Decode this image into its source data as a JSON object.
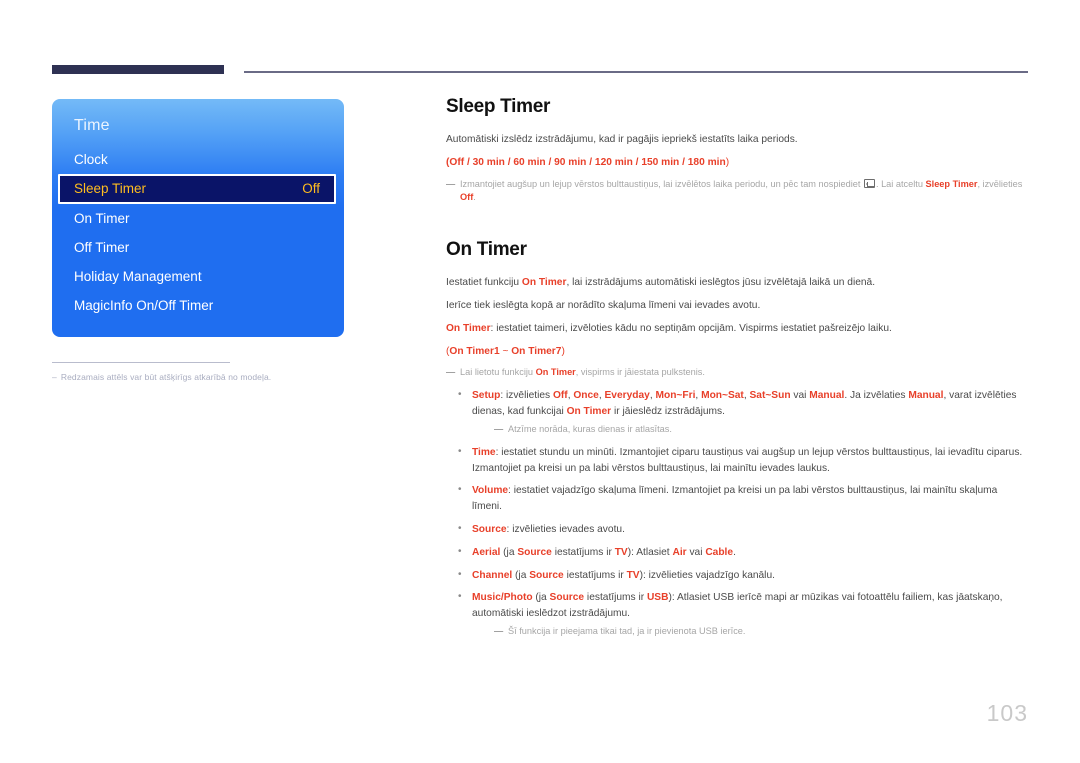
{
  "page": {
    "number": "103"
  },
  "osd": {
    "title": "Time",
    "items": [
      {
        "label": "Clock",
        "value": "",
        "selected": false
      },
      {
        "label": "Sleep Timer",
        "value": "Off",
        "selected": true
      },
      {
        "label": "On Timer",
        "value": "",
        "selected": false
      },
      {
        "label": "Off Timer",
        "value": "",
        "selected": false
      },
      {
        "label": "Holiday Management",
        "value": "",
        "selected": false
      },
      {
        "label": "MagicInfo On/Off Timer",
        "value": "",
        "selected": false
      }
    ],
    "footnote_dash": "–",
    "footnote": "Redzamais attēls var būt atšķirīgs atkarībā no modeļa."
  },
  "sleep_timer": {
    "heading": "Sleep Timer",
    "intro": "Automātiski izslēdz izstrādājumu, kad ir pagājis iepriekš iestatīts laika periods.",
    "options_line": {
      "open": "(",
      "values": "Off / 30 min / 60 min / 90 min / 120 min / 150 min / 180 min",
      "close": ")"
    },
    "note": {
      "dash": "—",
      "part1": "Izmantojiet augšup un lejup vērstos bulttaustiņus, lai izvēlētos laika periodu, un pēc tam nospiediet ",
      "icon": "enter-key-icon",
      "part2": ". Lai atceltu ",
      "accent1": "Sleep Timer",
      "part3": ", izvēlieties ",
      "accent2": "Off",
      "part4": "."
    }
  },
  "on_timer": {
    "heading": "On Timer",
    "line1_a": "Iestatiet funkciju ",
    "line1_accent": "On Timer",
    "line1_b": ", lai izstrādājums automātiski ieslēgtos jūsu izvēlētajā laikā un dienā.",
    "line2": "Ierīce tiek ieslēgta kopā ar norādīto skaļuma līmeni vai ievades avotu.",
    "line3_accent": "On Timer",
    "line3_b": ": iestatiet taimeri, izvēloties kādu no septiņām opcijām. Vispirms iestatiet pašreizējo laiku.",
    "range_line": {
      "open": "(",
      "a": "On Timer1",
      "tilde": " ~ ",
      "b": "On Timer7",
      "close": ")"
    },
    "note_clock": {
      "dash": "—",
      "a": "Lai lietotu funkciju ",
      "accent": "On Timer",
      "b": ", vispirms ir jāiestata pulkstenis."
    },
    "bullets": [
      {
        "id": "setup",
        "label": "Setup",
        "text_a": ": izvēlieties ",
        "opts": [
          "Off",
          "Once",
          "Everyday",
          "Mon~Fri",
          "Mon~Sat",
          "Sat~Sun"
        ],
        "text_b": " vai ",
        "opt_manual": "Manual",
        "text_c": ". Ja izvēlaties ",
        "opt_manual2": "Manual",
        "text_d": ", varat izvēlēties dienas, kad funkcijai ",
        "accent_ontimer": "On Timer",
        "text_e": " ir jāieslēdz izstrādājums.",
        "note": {
          "dash": "—",
          "text": "Atzīme norāda, kuras dienas ir atlasītas."
        }
      },
      {
        "id": "time",
        "label": "Time",
        "text_a": ": iestatiet stundu un minūti. Izmantojiet ciparu taustiņus vai augšup un lejup vērstos bulttaustiņus, lai ievadītu ciparus.",
        "text_b": "Izmantojiet pa kreisi un pa labi vērstos bulttaustiņus, lai mainītu ievades laukus."
      },
      {
        "id": "volume",
        "label": "Volume",
        "text_a": ": iestatiet vajadzīgo skaļuma līmeni. Izmantojiet pa kreisi un pa labi vērstos bulttaustiņus, lai mainītu skaļuma līmeni."
      },
      {
        "id": "source",
        "label": "Source",
        "text_a": ": izvēlieties ievades avotu."
      },
      {
        "id": "aerial",
        "label": "Aerial",
        "text_a": " (ja ",
        "accent_source": "Source",
        "text_b": " iestatījums ir ",
        "accent_tv": "TV",
        "text_c": "): Atlasiet ",
        "accent_air": "Air",
        "text_d": " vai ",
        "accent_cable": "Cable",
        "text_e": "."
      },
      {
        "id": "channel",
        "label": "Channel",
        "text_a": " (ja ",
        "accent_source": "Source",
        "text_b": " iestatījums ir ",
        "accent_tv": "TV",
        "text_c": "): izvēlieties vajadzīgo kanālu."
      },
      {
        "id": "music-photo",
        "label": "Music/Photo",
        "text_a": " (ja ",
        "accent_source": "Source",
        "text_b": " iestatījums ir ",
        "accent_usb": "USB",
        "text_c": "): Atlasiet USB ierīcē mapi ar mūzikas vai fotoattēlu failiem, kas jāatskaņo, automātiski ieslēdzot izstrādājumu.",
        "note": {
          "dash": "—",
          "text": "Šī funkcija ir pieejama tikai tad, ja ir pievienota USB ierīce."
        }
      }
    ]
  }
}
